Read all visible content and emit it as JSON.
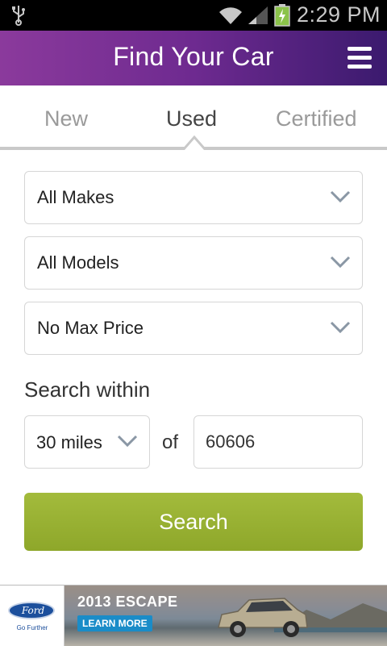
{
  "status_bar": {
    "time": "2:29 PM",
    "icons": [
      "usb-icon",
      "wifi-icon",
      "signal-icon",
      "battery-charging-icon"
    ]
  },
  "header": {
    "title": "Find Your Car",
    "menu_icon": "hamburger-menu-icon"
  },
  "tabs": [
    {
      "label": "New",
      "active": false
    },
    {
      "label": "Used",
      "active": true
    },
    {
      "label": "Certified",
      "active": false
    }
  ],
  "form": {
    "makes": "All Makes",
    "models": "All Models",
    "max_price": "No Max Price",
    "search_within_label": "Search within",
    "distance": "30 miles",
    "of_label": "of",
    "zip": "60606",
    "search_button": "Search"
  },
  "ad": {
    "brand": "Ford",
    "tagline": "Go Further",
    "headline": "2013 ESCAPE",
    "cta": "LEARN MORE"
  },
  "colors": {
    "header_gradient_start": "#8b3a9c",
    "header_gradient_end": "#3b1a6e",
    "search_button": "#9ab032",
    "ad_cta": "#1a8cc8"
  }
}
